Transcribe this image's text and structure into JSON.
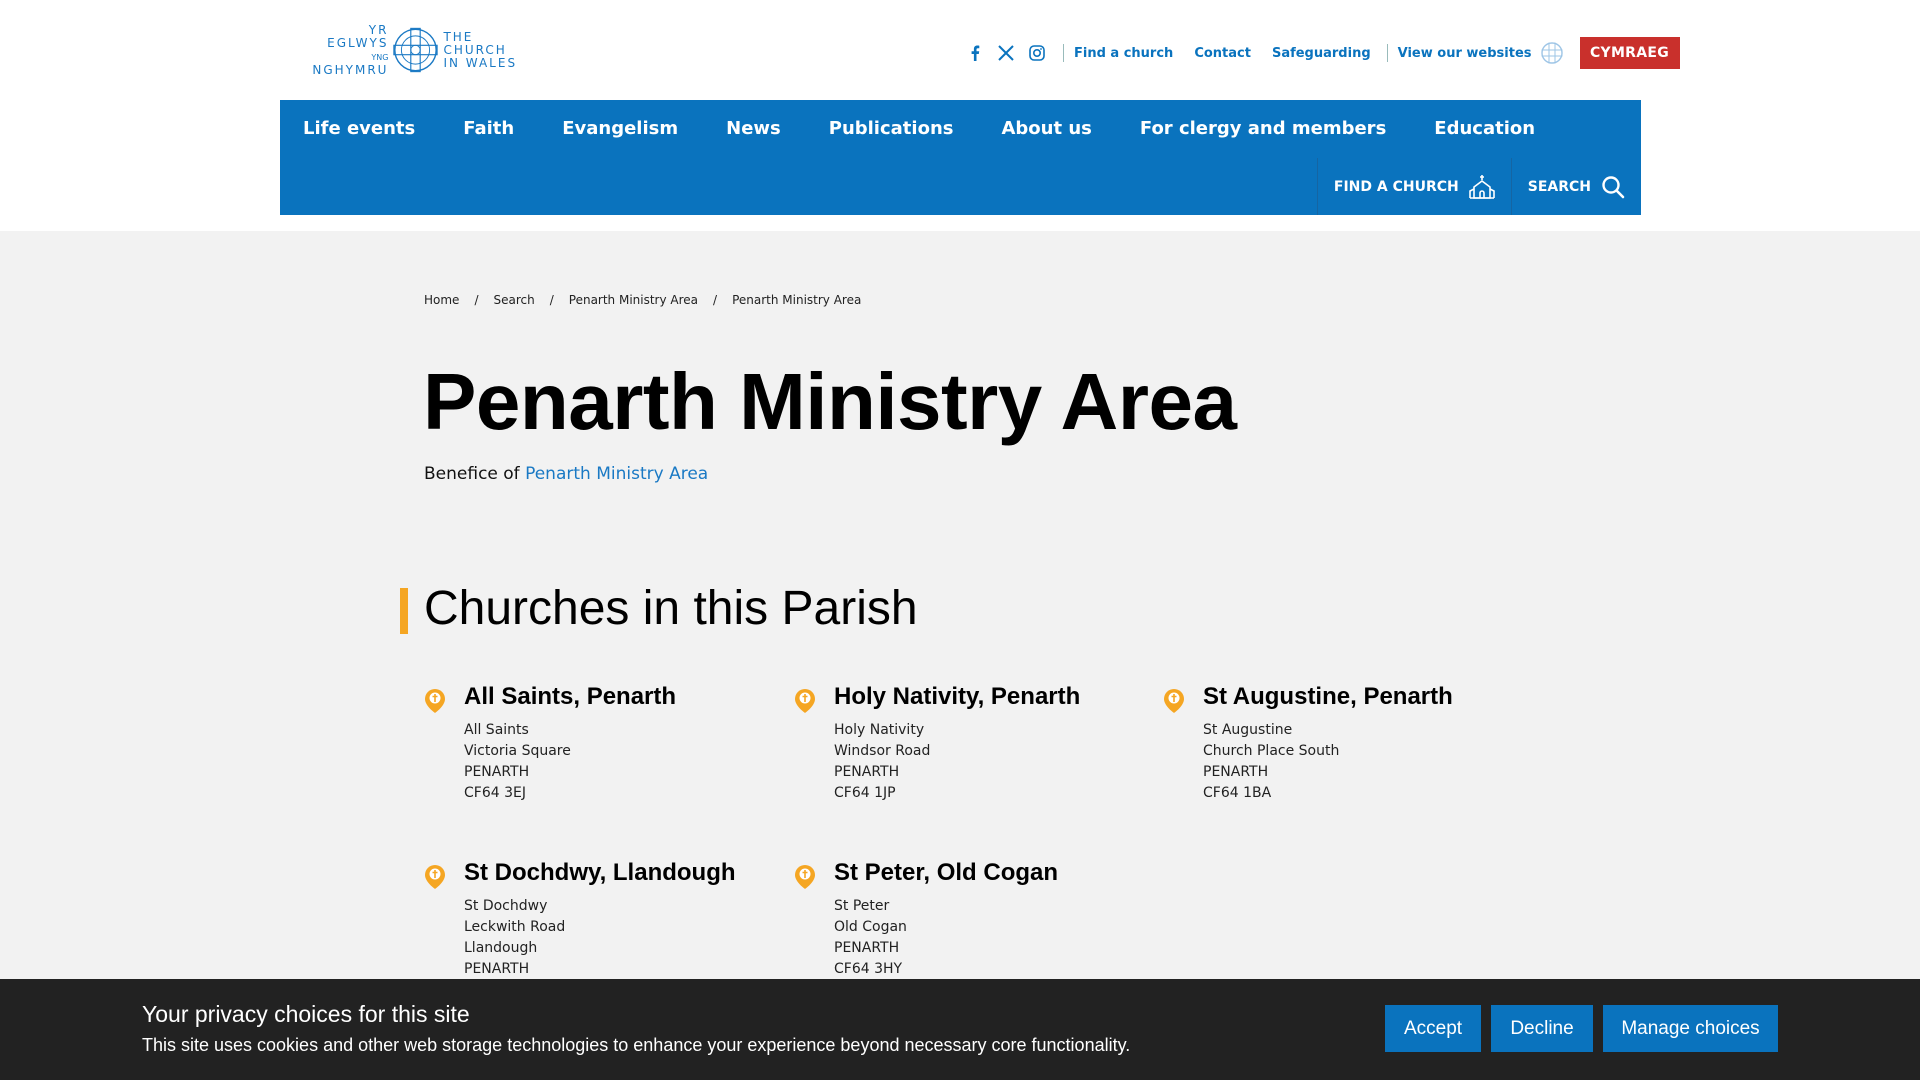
{
  "logo": {
    "welsh_line1": "YR EGLWYS",
    "welsh_line2_small": "YNG",
    "welsh_line2": "NGHYMRU",
    "english_line1": "THE CHURCH",
    "english_line2": "IN WALES"
  },
  "utility": {
    "links": [
      "Find a church",
      "Contact",
      "Safeguarding"
    ],
    "websites_label": "View our websites",
    "language_button": "CYMRAEG",
    "social_icons": [
      "facebook-icon",
      "x-icon",
      "instagram-icon"
    ]
  },
  "nav": {
    "items": [
      "Life events",
      "Faith",
      "Evangelism",
      "News",
      "Publications",
      "About us",
      "For clergy and members",
      "Education"
    ],
    "find_church": "FIND A CHURCH",
    "search": "SEARCH"
  },
  "breadcrumb": [
    "Home",
    "Search",
    "Penarth Ministry Area",
    "Penarth Ministry Area"
  ],
  "page": {
    "title": "Penarth Ministry Area",
    "benefice_prefix": "Benefice of",
    "benefice_link": "Penarth Ministry Area"
  },
  "section": {
    "title": "Churches in this Parish"
  },
  "churches": [
    {
      "name": "All Saints, Penarth",
      "address": [
        "All Saints",
        "Victoria Square",
        "PENARTH",
        "CF64 3EJ"
      ]
    },
    {
      "name": "Holy Nativity, Penarth",
      "address": [
        "Holy Nativity",
        "Windsor Road",
        "PENARTH",
        "CF64 1JP"
      ]
    },
    {
      "name": "St Augustine, Penarth",
      "address": [
        "St Augustine",
        "Church Place South",
        "PENARTH",
        "CF64 1BA"
      ]
    },
    {
      "name": "St Dochdwy, Llandough",
      "address": [
        "St Dochdwy",
        "Leckwith Road",
        "Llandough",
        "PENARTH"
      ]
    },
    {
      "name": "St Peter, Old Cogan",
      "address": [
        "St Peter",
        "Old Cogan",
        "PENARTH",
        "CF64 3HY"
      ]
    }
  ],
  "cookie": {
    "title": "Your privacy choices for this site",
    "text": "This site uses cookies and other web storage technologies to enhance your experience beyond necessary core functionality.",
    "accept": "Accept",
    "decline": "Decline",
    "manage": "Manage choices"
  },
  "colors": {
    "brand_blue": "#0a73be",
    "link_blue": "#1a79c4",
    "accent_orange": "#f5a623",
    "cymraeg_red": "#c9302c",
    "cookie_bg": "#222222"
  }
}
